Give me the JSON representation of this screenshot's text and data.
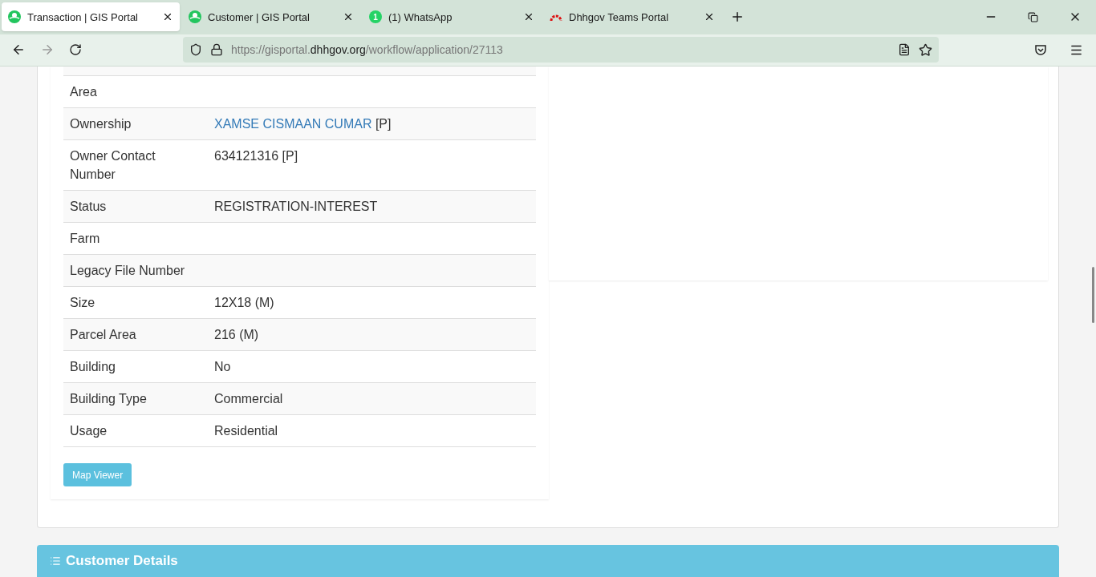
{
  "browser": {
    "tabs": [
      {
        "title": "Transaction | GIS Portal",
        "selected": true,
        "kind": "gis"
      },
      {
        "title": "Customer | GIS Portal",
        "selected": false,
        "kind": "gis"
      },
      {
        "title": "(1) WhatsApp",
        "selected": false,
        "kind": "chat",
        "badge": "1"
      },
      {
        "title": "Dhhgov Teams Portal",
        "selected": false,
        "kind": "arc"
      }
    ],
    "url_prefix": "https://gisportal.",
    "url_domain": "dhhgov.org",
    "url_path": "/workflow/application/27113"
  },
  "details": {
    "rows": [
      {
        "label": "Area"
      },
      {
        "label": "Ownership",
        "value_link": "XAMSE CISMAAN CUMAR",
        "value": "[P]"
      },
      {
        "label": "Owner Contact Number",
        "value": "634121316 [P]"
      },
      {
        "label": "Status",
        "value": "REGISTRATION-INTEREST"
      },
      {
        "label": "Farm"
      },
      {
        "label": "Legacy File Number"
      },
      {
        "label": "Size",
        "value": "12X18 (M)"
      },
      {
        "label": "Parcel Area",
        "value": "216 (M)"
      },
      {
        "label": "Building",
        "value": "No"
      },
      {
        "label": "Building Type",
        "value": "Commercial"
      },
      {
        "label": "Usage",
        "value": "Residential"
      }
    ],
    "button": "Map Viewer"
  },
  "section": {
    "title": "Customer Details"
  }
}
